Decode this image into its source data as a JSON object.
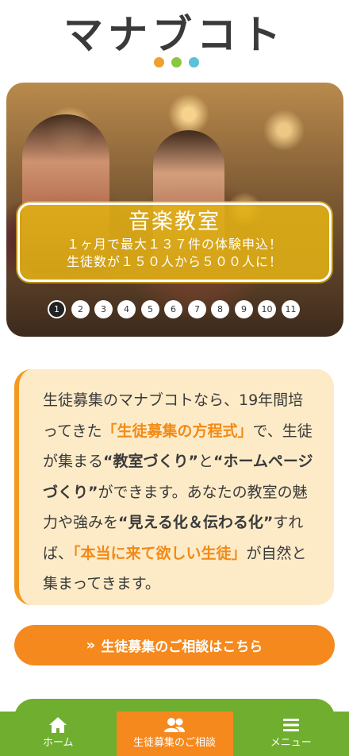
{
  "logo": {
    "text": "マナブコト",
    "dot_colors": [
      "#f0a033",
      "#8cc63f",
      "#5bc0d8"
    ]
  },
  "hero": {
    "title": "音楽教室",
    "line1": "１ヶ月で最大１３７件の体験申込！",
    "line2": "生徒数が１５０人から５００人に！",
    "pages": [
      "1",
      "2",
      "3",
      "4",
      "5",
      "6",
      "7",
      "8",
      "9",
      "10",
      "11"
    ],
    "active_page": 1
  },
  "info": {
    "p1": "生徒募集のマナブコトなら、19年間培ってきた",
    "hl1": "「生徒募集の方程式」",
    "p2": "で、生徒が集まる",
    "b1": "“教室づくり”",
    "p3": "と",
    "b2": "“ホームページづくり”",
    "p4": "ができます。あなたの教室の魅力や強みを",
    "b3": "“見える化＆伝わる化”",
    "p5": "すれば、",
    "hl2": "「本当に来て欲しい生徒」",
    "p6": "が自然と集まってきます。"
  },
  "cta": {
    "icon": "»",
    "label": "生徒募集のご相談はこちら"
  },
  "nav": {
    "home_label": "ホーム",
    "consult_label": "生徒募集のご相談",
    "menu_label": "メニュー"
  },
  "colors": {
    "accent_orange": "#f5891e",
    "green": "#6fae2f",
    "panel_yellow": "#e2b214",
    "card_bg": "#fdebc8"
  }
}
